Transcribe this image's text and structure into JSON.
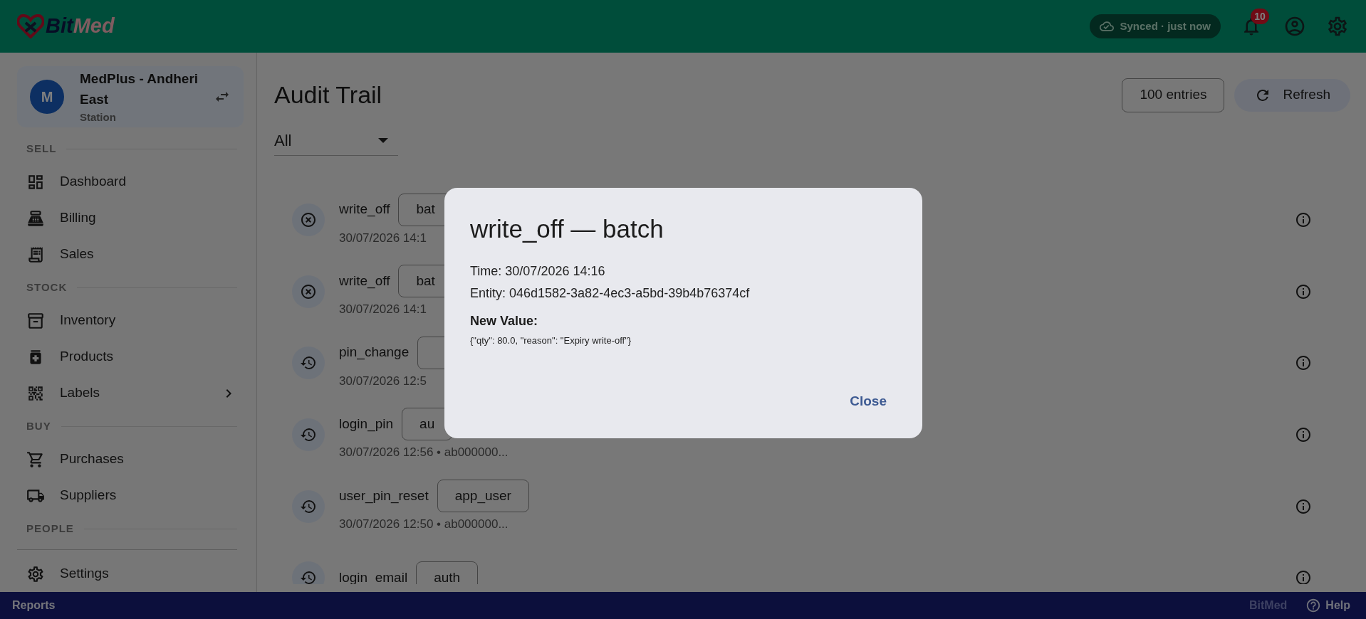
{
  "header": {
    "logo": {
      "prefix": "Bit",
      "suffix": "Med"
    },
    "sync": "Synced · just now",
    "notifications_badge": "10"
  },
  "sidebar": {
    "store": {
      "avatar": "M",
      "name": "MedPlus - Andheri East",
      "role": "Station"
    },
    "sections": [
      {
        "label": "SELL",
        "items": [
          {
            "label": "Dashboard",
            "selected": false,
            "expandable": false
          },
          {
            "label": "Billing",
            "selected": false,
            "expandable": false
          },
          {
            "label": "Sales",
            "selected": false,
            "expandable": false
          }
        ]
      },
      {
        "label": "STOCK",
        "items": [
          {
            "label": "Inventory",
            "selected": false,
            "expandable": false
          },
          {
            "label": "Products",
            "selected": false,
            "expandable": false
          },
          {
            "label": "Labels",
            "selected": false,
            "expandable": true
          }
        ]
      },
      {
        "label": "BUY",
        "items": [
          {
            "label": "Purchases",
            "selected": false,
            "expandable": false
          },
          {
            "label": "Suppliers",
            "selected": false,
            "expandable": false
          }
        ]
      },
      {
        "label": "PEOPLE"
      }
    ],
    "bottom_items": [
      {
        "label": "Settings",
        "selected": false,
        "expandable": false
      }
    ]
  },
  "main": {
    "title": "Audit Trail",
    "filter": {
      "value": "All"
    },
    "entries_count": "100 entries",
    "refresh": "Refresh",
    "rows": [
      {
        "kind": "removal",
        "action": "write_off",
        "has_tag": true,
        "tag": "bat",
        "meta": "30/07/2026 14:1"
      },
      {
        "kind": "removal",
        "action": "write_off",
        "has_tag": true,
        "tag": "bat",
        "meta": "30/07/2026 14:1"
      },
      {
        "kind": "update",
        "action": "pin_change",
        "has_tag": true,
        "meta": "30/07/2026 12:5"
      },
      {
        "kind": "update",
        "action": "login_pin",
        "has_tag": true,
        "tag": "au",
        "meta": "30/07/2026 12:56 • ab000000..."
      },
      {
        "kind": "update",
        "action": "user_pin_reset",
        "has_tag": true,
        "tag": "app_user",
        "meta": "30/07/2026 12:50 • ab000000..."
      },
      {
        "kind": "update",
        "action": "login_email",
        "has_tag": true,
        "tag": "auth"
      }
    ]
  },
  "dialog": {
    "title": "write_off — batch",
    "lines": [
      "Time: 30/07/2026 14:16",
      "Entity: 046d1582-3a82-4ec3-a5bd-39b4b76374cf"
    ],
    "new_value_label": "New Value:",
    "new_value": "{\"qty\": 80.0, \"reason\": \"Expiry write-off\"}",
    "close": "Close"
  },
  "footer": {
    "left": "Reports",
    "brand": "BitMed",
    "help": "Help"
  }
}
